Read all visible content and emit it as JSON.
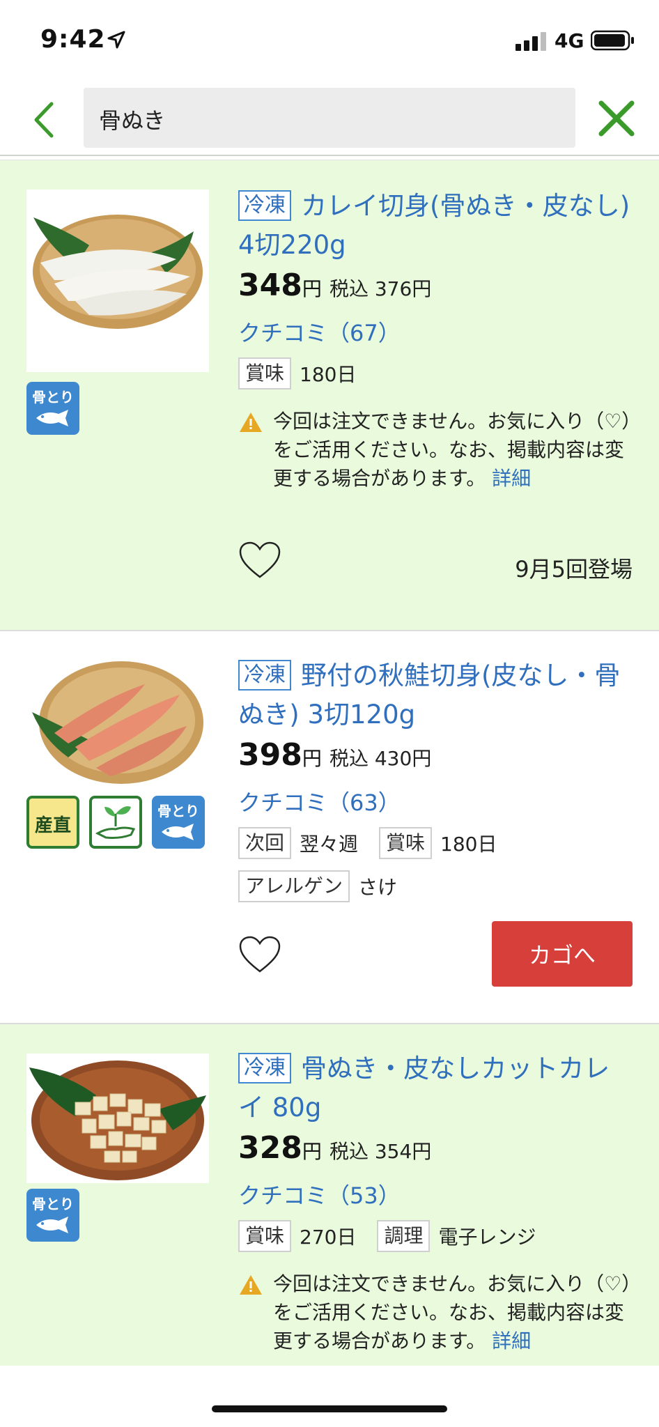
{
  "status": {
    "time": "9:42",
    "network": "4G"
  },
  "search": {
    "query": "骨ぬき"
  },
  "products": [
    {
      "freeze_label": "冷凍",
      "title": "カレイ切身(骨ぬき・皮なし) 4切220g",
      "price": "348",
      "yen": "円",
      "tax_in": "税込 376円",
      "reviews": "クチコミ（67）",
      "meta": [
        {
          "tag": "賞味",
          "value": "180日"
        }
      ],
      "badges": [
        {
          "type": "bone",
          "label": "骨とり"
        }
      ],
      "notice": "今回は注文できません。お気に入り（♡）をご活用ください。なお、掲載内容は変更する場合があります。",
      "notice_link": "詳細",
      "appearance": "9月5回登場",
      "colors": {
        "background": "#e9fbdc"
      }
    },
    {
      "freeze_label": "冷凍",
      "title": "野付の秋鮭切身(皮なし・骨ぬき) 3切120g",
      "price": "398",
      "yen": "円",
      "tax_in": "税込 430円",
      "reviews": "クチコミ（63）",
      "meta": [
        {
          "tag": "次回",
          "value": "翌々週"
        },
        {
          "tag": "賞味",
          "value": "180日"
        }
      ],
      "allergen": {
        "tag": "アレルゲン",
        "value": "さけ"
      },
      "badges": [
        {
          "type": "direct",
          "label": "産直"
        },
        {
          "type": "eco",
          "label": "sprout-hand-icon"
        },
        {
          "type": "bone",
          "label": "骨とり"
        }
      ],
      "cart_label": "カゴへ",
      "colors": {
        "background": "#ffffff",
        "cart": "#d63f3a"
      }
    },
    {
      "freeze_label": "冷凍",
      "title": "骨ぬき・皮なしカットカレイ 80g",
      "price": "328",
      "yen": "円",
      "tax_in": "税込 354円",
      "reviews": "クチコミ（53）",
      "meta": [
        {
          "tag": "賞味",
          "value": "270日"
        },
        {
          "tag": "調理",
          "value": "電子レンジ"
        }
      ],
      "badges": [
        {
          "type": "bone",
          "label": "骨とり"
        }
      ],
      "notice": "今回は注文できません。お気に入り（♡）をご活用ください。なお、掲載内容は変更する場合があります。",
      "notice_link": "詳細",
      "colors": {
        "background": "#e9fbdc"
      }
    }
  ],
  "colors": {
    "accent_green": "#3a9a2a",
    "link_blue": "#2f6fbd",
    "badge_blue": "#3d88cf"
  }
}
